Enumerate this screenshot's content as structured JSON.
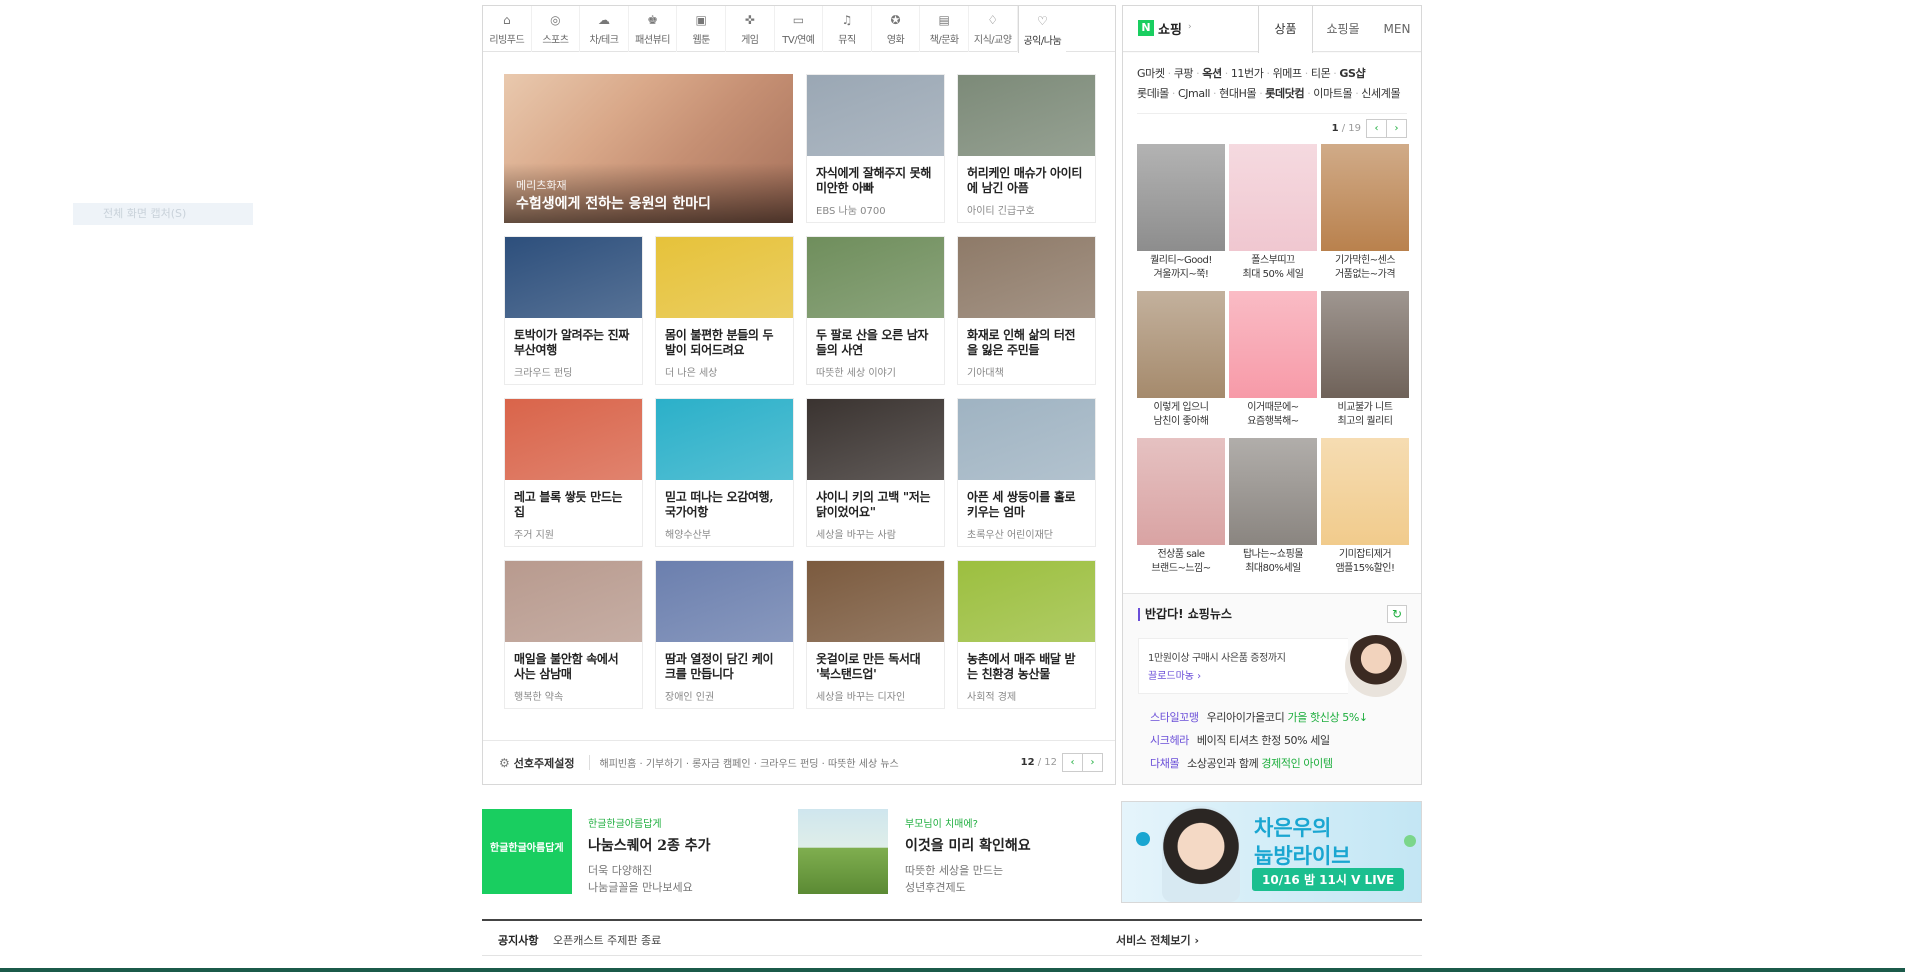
{
  "capture_hint": "전체 화면 캡처(S)",
  "tabs": [
    {
      "label": "리빙푸드",
      "icon": "house-icon"
    },
    {
      "label": "스포츠",
      "icon": "ball-icon"
    },
    {
      "label": "차/테크",
      "icon": "car-icon"
    },
    {
      "label": "패션뷰티",
      "icon": "lipstick-icon"
    },
    {
      "label": "웹툰",
      "icon": "webtoon-icon"
    },
    {
      "label": "게임",
      "icon": "gamepad-icon"
    },
    {
      "label": "TV/연예",
      "icon": "tv-icon"
    },
    {
      "label": "뮤직",
      "icon": "music-icon"
    },
    {
      "label": "영화",
      "icon": "film-reel-icon"
    },
    {
      "label": "책/문화",
      "icon": "book-icon"
    },
    {
      "label": "지식/교양",
      "icon": "knowledge-icon"
    },
    {
      "label": "공익/나눔",
      "icon": "heart-icon"
    }
  ],
  "featured": {
    "caption": "메리츠화재",
    "title": "수험생에게 전하는 응원의 한마디"
  },
  "cards": [
    {
      "title": "자식에게 잘해주지 못해 미안한 아빠",
      "source": "EBS 나눔 0700",
      "color": "#9aa7b4"
    },
    {
      "title": "허리케인 매슈가 아이티에 남긴 아픔",
      "source": "아이티 긴급구호",
      "color": "#7c8a78"
    },
    {
      "title": "토박이가 알려주는 진짜 부산여행",
      "source": "크라우드 펀딩",
      "color": "#2d4f7c"
    },
    {
      "title": "몸이 불편한 분들의 두 발이 되어드려요",
      "source": "더 나은 세상",
      "color": "#e6c23a"
    },
    {
      "title": "두 팔로 산을 오른 남자들의 사연",
      "source": "따뜻한 세상 이야기",
      "color": "#6f8e5c"
    },
    {
      "title": "화재로 인해 삶의 터전을 잃은 주민들",
      "source": "기아대책",
      "color": "#8e7a68"
    },
    {
      "title": "레고 블록 쌓듯 만드는 집",
      "source": "주거 지원",
      "color": "#d9644a"
    },
    {
      "title": "믿고 떠나는 오감여행, 국가어항",
      "source": "해양수산부",
      "color": "#2bb0c9"
    },
    {
      "title": "샤이니 키의 고백 \"저는 닭이었어요\"",
      "source": "세상을 바꾸는 사람",
      "color": "#3a3330"
    },
    {
      "title": "아픈 세 쌍둥이를 홀로 키우는 엄마",
      "source": "초록우산 어린이재단",
      "color": "#9fb3c2"
    },
    {
      "title": "매일을 불안함 속에서 사는 삼남매",
      "source": "행복한 약속",
      "color": "#b89a8e"
    },
    {
      "title": "땀과 열정이 담긴 케이크를 만듭니다",
      "source": "장애인 인권",
      "color": "#6b7fae"
    },
    {
      "title": "옷걸이로 만든 독서대 '북스탠드업'",
      "source": "세상을 바꾸는 디자인",
      "color": "#7b5a3e"
    },
    {
      "title": "농촌에서 매주 배달 받는 친환경 농산물",
      "source": "사회적 경제",
      "color": "#9cbf3f"
    }
  ],
  "footer": {
    "pref_label": "선호주제설정",
    "themes": "해피빈홈 · 기부하기 · 롱자금 캠페인 · 크라우드 펀딩 · 따뜻한 세상 뉴스",
    "page_current": "12",
    "page_total": "/ 12",
    "prev": "‹",
    "next": "›"
  },
  "shop": {
    "logo": "N",
    "title": "쇼핑",
    "arrow": "›",
    "tab_products": "상품",
    "tab_malls": "쇼핑몰",
    "tab_men": "MEN",
    "malls_row1": [
      {
        "name": "G마켓",
        "bold": false
      },
      {
        "name": "쿠팡",
        "bold": false
      },
      {
        "name": "옥션",
        "bold": true
      },
      {
        "name": "11번가",
        "bold": false
      },
      {
        "name": "위메프",
        "bold": false
      },
      {
        "name": "티몬",
        "bold": false
      },
      {
        "name": "GS샵",
        "bold": true
      }
    ],
    "malls_row2": [
      {
        "name": "롯데i몰",
        "bold": false
      },
      {
        "name": "CJmall",
        "bold": false
      },
      {
        "name": "현대H몰",
        "bold": false
      },
      {
        "name": "롯데닷컴",
        "bold": true
      },
      {
        "name": "이마트몰",
        "bold": false
      },
      {
        "name": "신세계몰",
        "bold": false
      }
    ],
    "page_current": "1",
    "page_total": "/ 19",
    "products": [
      {
        "line1": "퀄리티~Good!",
        "line2": "겨울까지~쭉!",
        "color": "#8d8d8d"
      },
      {
        "line1": "폴스부띠끄",
        "line2": "최대 50% 세일",
        "color": "#f0c7d0"
      },
      {
        "line1": "기가막힌~센스",
        "line2": "거품없는~가격",
        "color": "#b9814d"
      },
      {
        "line1": "이렇게 입으니",
        "line2": "남친이 좋아해",
        "color": "#a58a6c"
      },
      {
        "line1": "이거때문에~",
        "line2": "요즘행복해~",
        "color": "#f79aa8"
      },
      {
        "line1": "비교불가 니트",
        "line2": "최고의 퀄리티",
        "color": "#6f6259"
      },
      {
        "line1": "전상품 sale",
        "line2": "브랜드~느낌~",
        "color": "#d9a3a3"
      },
      {
        "line1": "탑나는~쇼핑몰",
        "line2": "최대80%세일",
        "color": "#8a8580"
      },
      {
        "line1": "기미잡티제거",
        "line2": "앰플15%할인!",
        "color": "#f1cb8c"
      }
    ]
  },
  "shop_news": {
    "title": "반갑다! 쇼핑뉴스",
    "refresh": "↻",
    "box_line1": "1만원이상 구매시 사은품 증정까지",
    "box_line2": "끌로드마농 ›",
    "rows": [
      {
        "cat": "스타일꼬맹",
        "text": "우리아이가을코디 ",
        "hl": "가을 핫신상 5%↓"
      },
      {
        "cat": "시크헤라",
        "text": "베이직 티셔츠 한정 50% 세일",
        "hl": ""
      },
      {
        "cat": "다채몰",
        "text": "소상공인과 함께 ",
        "hl": "경제적인 아이템"
      }
    ]
  },
  "banners": {
    "b1_logo": "한글한글아름답게",
    "b1_kicker": "한글한글아름답게",
    "b1_title": "나눔스퀘어 2종 추가",
    "b1_desc1": "더욱 다양해진",
    "b1_desc2": "나눔글꼴을 만나보세요",
    "b2_kicker": "부모님이 치매에?",
    "b2_title": "이것을 미리 확인해요",
    "b2_desc1": "따뜻한 세상을 만드는",
    "b2_desc2": "성년후견제도"
  },
  "ad": {
    "line1": "차은우의",
    "line2": "눕방라이브",
    "line3": "10/16 밤 11시 V LIVE"
  },
  "notice": {
    "label": "공지사항",
    "text": "오픈캐스트 주제판 종료",
    "all_services": "서비스 전체보기 ›"
  }
}
